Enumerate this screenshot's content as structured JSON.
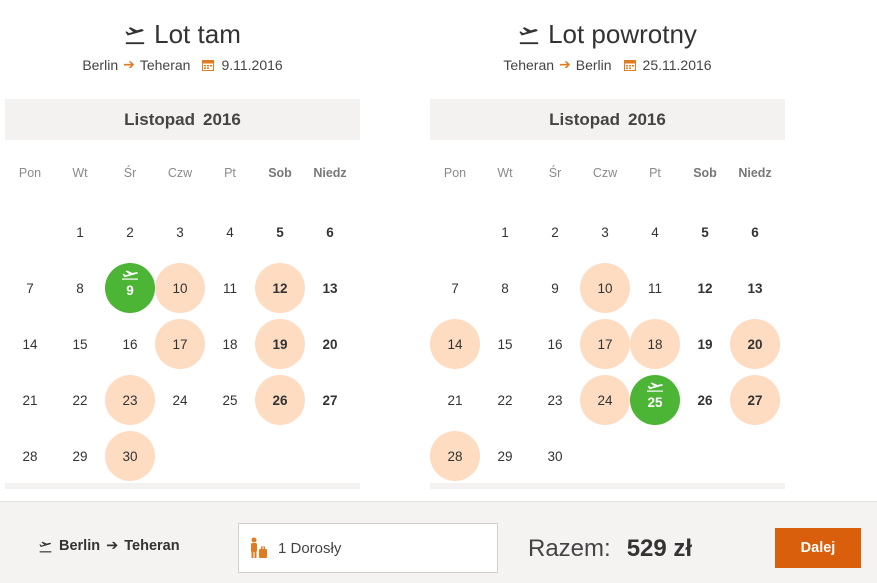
{
  "colors": {
    "accent": "#d95f0c",
    "selected": "#4cb535",
    "available": "#fddcc2",
    "arrow": "#e07b22"
  },
  "outbound": {
    "title": "Lot tam",
    "from": "Berlin",
    "to": "Teheran",
    "date": "9.11.2016",
    "month": "Listopad",
    "year": "2016",
    "weekdays": [
      "Pon",
      "Wt",
      "Śr",
      "Czw",
      "Pt",
      "Sob",
      "Niedz"
    ],
    "first_day_offset": 1,
    "days_in_month": 30,
    "available_days": [
      10,
      12,
      17,
      19,
      23,
      26,
      30
    ],
    "selected_day": 9
  },
  "return": {
    "title": "Lot powrotny",
    "from": "Teheran",
    "to": "Berlin",
    "date": "25.11.2016",
    "month": "Listopad",
    "year": "2016",
    "weekdays": [
      "Pon",
      "Wt",
      "Śr",
      "Czw",
      "Pt",
      "Sob",
      "Niedz"
    ],
    "first_day_offset": 1,
    "days_in_month": 30,
    "available_days": [
      10,
      14,
      17,
      18,
      20,
      24,
      27,
      28
    ],
    "selected_day": 25
  },
  "footer": {
    "route_from": "Berlin",
    "route_to": "Teheran",
    "route_arrow": "➔",
    "passengers": "1 Dorosły",
    "total_label": "Razem:",
    "total_amount": "529 zł",
    "next_label": "Dalej"
  }
}
